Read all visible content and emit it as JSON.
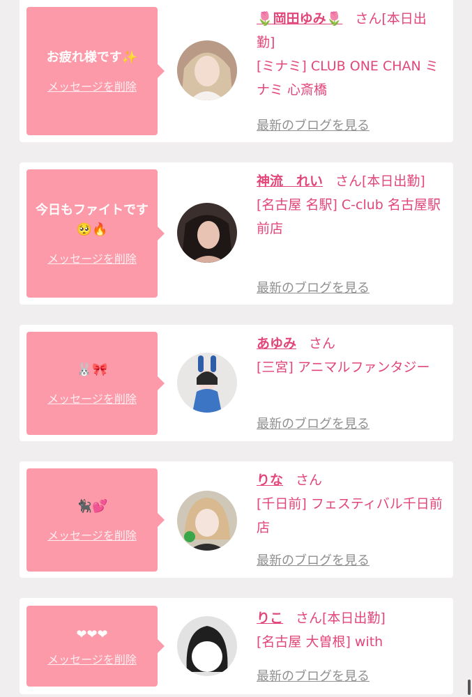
{
  "cards": [
    {
      "message": "お疲れ様です✨",
      "delete_label": "メッセージを削除",
      "name": "🌷岡田ゆみ🌷",
      "suffix": "さん[本日出勤]",
      "shop": "[ミナミ] CLUB ONE CHAN ミナミ 心斎橋",
      "blog_label": "最新のブログを見る"
    },
    {
      "message": "今日もファイトです🥺🔥",
      "delete_label": "メッセージを削除",
      "name": "神流　れい",
      "suffix": "さん[本日出勤]",
      "shop": "[名古屋 名駅] C-club 名古屋駅前店",
      "blog_label": "最新のブログを見る"
    },
    {
      "message": "🐰🎀",
      "delete_label": "メッセージを削除",
      "name": "あゆみ",
      "suffix": "さん",
      "shop": "[三宮] アニマルファンタジー",
      "blog_label": "最新のブログを見る"
    },
    {
      "message": "🐈‍⬛💕",
      "delete_label": "メッセージを削除",
      "name": "りな",
      "suffix": "さん",
      "shop": "[千日前] フェスティバル千日前店",
      "blog_label": "最新のブログを見る"
    },
    {
      "message": "❤❤❤",
      "delete_label": "メッセージを削除",
      "name": "りこ",
      "suffix": "さん[本日出勤]",
      "shop": "[名古屋 大曽根] with",
      "blog_label": "最新のブログを見る"
    }
  ],
  "colors": {
    "accent": "#e24679",
    "bubble": "#fd9aa9",
    "background": "#f0eeee",
    "link_gray": "#8f8f8f"
  }
}
